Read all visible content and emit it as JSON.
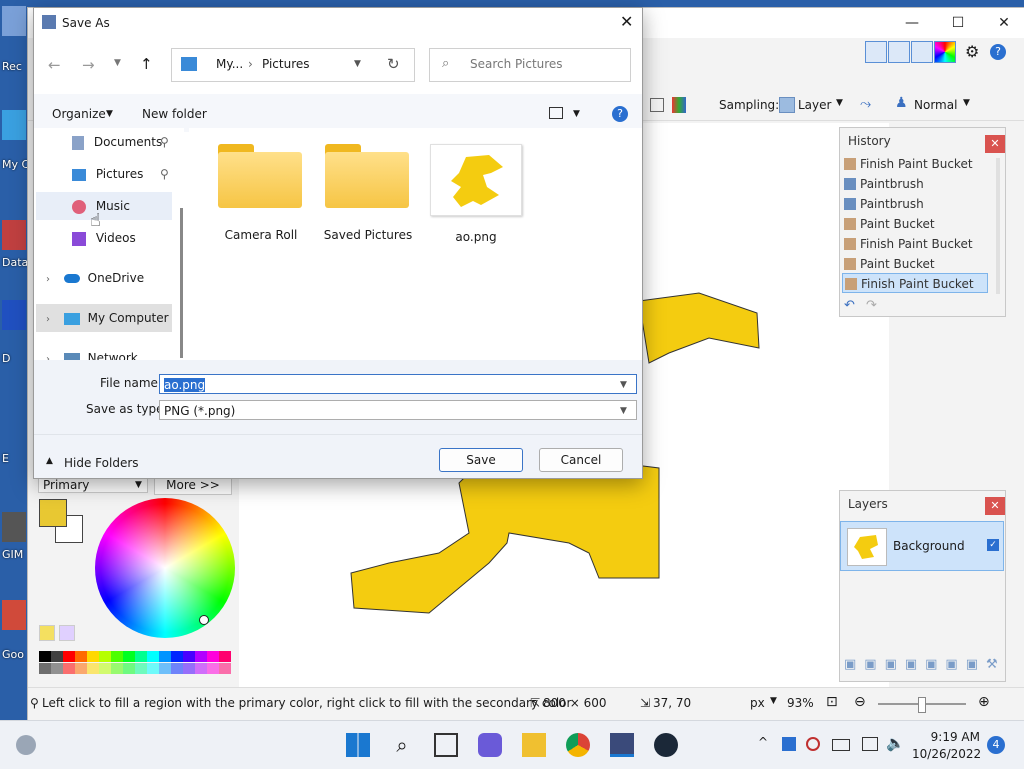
{
  "desktop": {
    "icons": [
      {
        "label": "Rec"
      },
      {
        "label": "My C"
      },
      {
        "label": "Data"
      },
      {
        "label": "D"
      },
      {
        "label": "E"
      },
      {
        "label": "GIM"
      },
      {
        "label": "Goo"
      }
    ]
  },
  "paint": {
    "toolbar": {
      "sampling_label": "Sampling:",
      "sampling_value": "Layer",
      "blend_mode": "Normal"
    },
    "palette": {
      "mode": "Primary",
      "more_button": "More >>",
      "primary_color": "#e8c832",
      "secondary_color": "#ffffff"
    },
    "history": {
      "title": "History",
      "items": [
        {
          "label": "Finish Paint Bucket",
          "selected": false
        },
        {
          "label": "Paintbrush",
          "selected": false
        },
        {
          "label": "Paintbrush",
          "selected": false
        },
        {
          "label": "Paint Bucket",
          "selected": false
        },
        {
          "label": "Finish Paint Bucket",
          "selected": false
        },
        {
          "label": "Paint Bucket",
          "selected": false
        },
        {
          "label": "Finish Paint Bucket",
          "selected": true
        }
      ]
    },
    "layers": {
      "title": "Layers",
      "items": [
        {
          "label": "Background"
        }
      ]
    },
    "status": {
      "hint": "Left click to fill a region with the primary color, right click to fill with the secondary color",
      "size": "800 × 600",
      "cursor": "37, 70",
      "unit": "px",
      "zoom": "93%"
    },
    "swatches": [
      "#000000",
      "#404040",
      "#ff0000",
      "#ff6a00",
      "#ffd800",
      "#b6ff00",
      "#4cff00",
      "#00ff21",
      "#00ff90",
      "#00ffff",
      "#0094ff",
      "#0026ff",
      "#4800ff",
      "#b200ff",
      "#ff00dc",
      "#ff006e"
    ]
  },
  "dialog": {
    "title": "Save As",
    "breadcrumb": [
      "My...",
      "Pictures"
    ],
    "search_placeholder": "Search Pictures",
    "organize": "Organize",
    "new_folder": "New folder",
    "tree": [
      {
        "label": "Documents"
      },
      {
        "label": "Pictures"
      },
      {
        "label": "Music"
      },
      {
        "label": "Videos"
      },
      {
        "label": "OneDrive"
      },
      {
        "label": "My Computer"
      },
      {
        "label": "Network"
      }
    ],
    "files": [
      {
        "label": "Camera Roll"
      },
      {
        "label": "Saved Pictures"
      },
      {
        "label": "ao.png"
      }
    ],
    "file_name_label": "File name:",
    "file_name_value": "ao.png",
    "save_type_label": "Save as type:",
    "save_type_value": "PNG (*.png)",
    "hide_folders": "Hide Folders",
    "save": "Save",
    "cancel": "Cancel"
  },
  "taskbar": {
    "time": "9:19 AM",
    "date": "10/26/2022",
    "notifications": "4"
  }
}
